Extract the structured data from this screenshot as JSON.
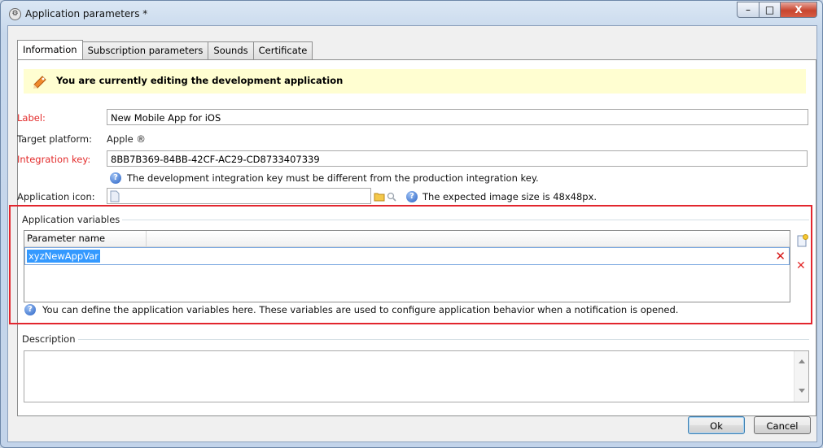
{
  "window": {
    "title": "Application parameters *",
    "minimize_label": "–",
    "maximize_label": "□",
    "close_label": "X"
  },
  "tabs": [
    {
      "label": "Information",
      "active": true
    },
    {
      "label": "Subscription parameters",
      "active": false
    },
    {
      "label": "Sounds",
      "active": false
    },
    {
      "label": "Certificate",
      "active": false
    }
  ],
  "banner": {
    "text": "You are currently editing the development application",
    "icon": "edit-pencil-icon"
  },
  "form": {
    "label_label": "Label:",
    "label_value": "New Mobile App for iOS",
    "platform_label": "Target platform:",
    "platform_value": "Apple ®",
    "integration_label": "Integration key:",
    "integration_value": "8BB7B369-84BB-42CF-AC29-CD8733407339",
    "integration_note": "The development integration key must be different from the production integration key.",
    "icon_label": "Application icon:",
    "icon_note": "The expected image size is 48x48px."
  },
  "variables": {
    "group_title": "Application variables",
    "column_header": "Parameter name",
    "rows": [
      "xyzNewAppVar"
    ],
    "note": "You can define the application variables here. These variables are used to configure application behavior when a notification is opened."
  },
  "description": {
    "group_title": "Description"
  },
  "buttons": {
    "ok": "Ok",
    "cancel": "Cancel"
  },
  "colors": {
    "required_label": "#e32b2b",
    "banner_bg": "#fffed1",
    "highlight_box": "#e2262e",
    "selection": "#3399ff"
  }
}
